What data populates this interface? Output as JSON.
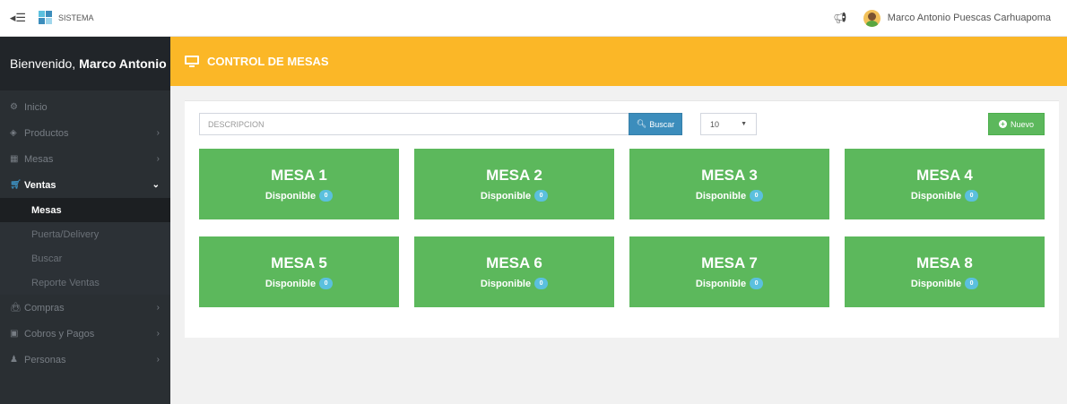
{
  "topbar": {
    "brand": "SISTEMA",
    "user_name": "Marco Antonio Puescas Carhuapoma"
  },
  "sidebar": {
    "welcome_prefix": "Bienvenido,",
    "welcome_name": "Marco Antonio",
    "items": [
      {
        "label": "Inicio",
        "icon": "dashboard-icon"
      },
      {
        "label": "Productos",
        "icon": "cube-icon"
      },
      {
        "label": "Mesas",
        "icon": "grid-icon"
      },
      {
        "label": "Ventas",
        "icon": "cart-icon"
      },
      {
        "label": "Compras",
        "icon": "shopping-bag-icon"
      },
      {
        "label": "Cobros y Pagos",
        "icon": "money-icon"
      },
      {
        "label": "Personas",
        "icon": "user-icon"
      }
    ],
    "ventas_sub": [
      "Mesas",
      "Puerta/Delivery",
      "Buscar",
      "Reporte Ventas"
    ]
  },
  "header": {
    "title": "CONTROL DE MESAS"
  },
  "toolbar": {
    "search_placeholder": "DESCRIPCION",
    "search_button": "Buscar",
    "page_size": "10",
    "new_button": "Nuevo"
  },
  "mesas": [
    {
      "name": "MESA 1",
      "status": "Disponible",
      "count": "0"
    },
    {
      "name": "MESA 2",
      "status": "Disponible",
      "count": "0"
    },
    {
      "name": "MESA 3",
      "status": "Disponible",
      "count": "0"
    },
    {
      "name": "MESA 4",
      "status": "Disponible",
      "count": "0"
    },
    {
      "name": "MESA 5",
      "status": "Disponible",
      "count": "0"
    },
    {
      "name": "MESA 6",
      "status": "Disponible",
      "count": "0"
    },
    {
      "name": "MESA 7",
      "status": "Disponible",
      "count": "0"
    },
    {
      "name": "MESA 8",
      "status": "Disponible",
      "count": "0"
    }
  ],
  "colors": {
    "header_accent": "#fbb727",
    "mesa_available": "#5cb85c",
    "primary_button": "#3c8dbc",
    "badge": "#5bc0de",
    "sidebar": "#2a2f33"
  }
}
